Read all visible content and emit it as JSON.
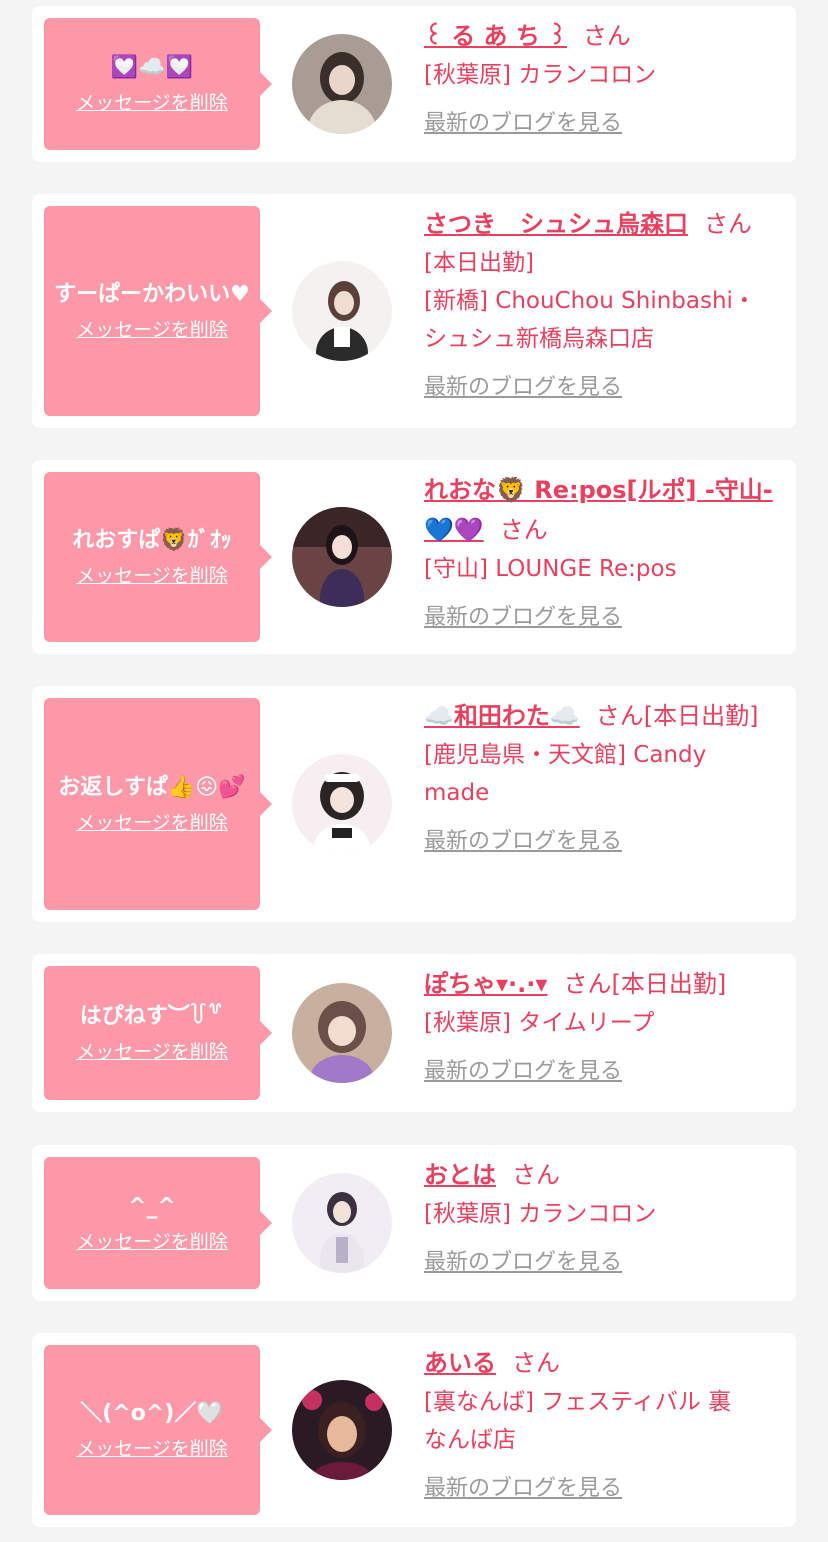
{
  "cards": [
    {
      "message": "💟☁️💟",
      "delete_label": "メッセージを削除",
      "name": "꒰ る あ ち ꒱",
      "honorific": "さん",
      "extra": "",
      "shop_lines": [
        "[秋葉原] カランコロン"
      ],
      "blog_label": "最新のブログを見る",
      "avatar_colors": [
        "#6b5a52",
        "#d9cfc6",
        "#3a2e2b"
      ]
    },
    {
      "message": "すーぱーかわいい♥",
      "delete_label": "メッセージを削除",
      "name": "さつき　シュシュ烏森口",
      "honorific": "さん",
      "extra": "",
      "shop_lines": [
        "[本日出勤]",
        "[新橋] ChouChou Shinbashi・",
        "シュシュ新橋烏森口店"
      ],
      "blog_label": "最新のブログを見る",
      "avatar_colors": [
        "#f2f2f2",
        "#e6e0dc",
        "#4a3a36"
      ]
    },
    {
      "message": "れおすぱ🦁ｶﾞｵｯ",
      "delete_label": "メッセージを削除",
      "name": "れおな🦁 Re:pos[ルポ] -守山-💙💜",
      "honorific": "さん",
      "extra": "",
      "shop_lines": [
        "[守山] LOUNGE Re:pos"
      ],
      "blog_label": "最新のブログを見る",
      "avatar_colors": [
        "#5a3a3a",
        "#8a5a5a",
        "#2a1e30"
      ]
    },
    {
      "message": "お返しすぱ👍😖💕",
      "delete_label": "メッセージを削除",
      "name": "☁️和田わた☁️",
      "honorific": "さん",
      "extra": "[本日出勤]",
      "shop_lines": [
        "[鹿児島県・天文館] Candy",
        "made"
      ],
      "blog_label": "最新のブログを見る",
      "avatar_colors": [
        "#f3e4ea",
        "#ffffff",
        "#2b2424"
      ]
    },
    {
      "message": "はぴねす︶꒦꒷",
      "delete_label": "メッセージを削除",
      "name": "ぽちゃ▾·.·▾",
      "honorific": "さん",
      "extra": "[本日出勤]",
      "shop_lines": [
        "[秋葉原] タイムリープ"
      ],
      "blog_label": "最新のブログを見る",
      "avatar_colors": [
        "#6a5048",
        "#a07ac8",
        "#e8cbbd"
      ]
    },
    {
      "message": "^_^",
      "delete_label": "メッセージを削除",
      "name": "おとは",
      "honorific": "さん",
      "extra": "",
      "shop_lines": [
        "[秋葉原] カランコロン"
      ],
      "blog_label": "最新のブログを見る",
      "avatar_colors": [
        "#eeeaf2",
        "#d8d4e0",
        "#3a3040"
      ]
    },
    {
      "message": "＼(^o^)／🤍",
      "delete_label": "メッセージを削除",
      "name": "あいる",
      "honorific": "さん",
      "extra": "",
      "shop_lines": [
        "[裏なんば] フェスティバル 裏",
        "なんば店"
      ],
      "blog_label": "最新のブログを見る",
      "avatar_colors": [
        "#2a1a24",
        "#c43060",
        "#e8b89a"
      ]
    }
  ]
}
